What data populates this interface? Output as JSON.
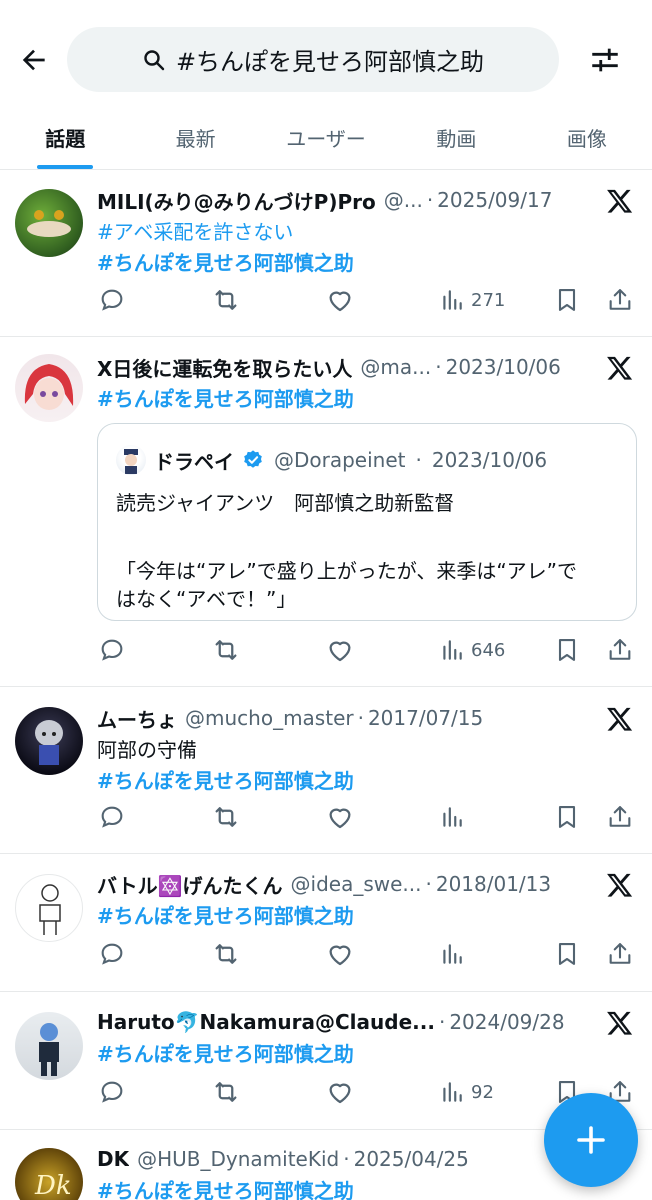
{
  "header": {
    "search_query": "#ちんぽを見せろ阿部慎之助"
  },
  "tabs": [
    {
      "label": "話題",
      "active": true
    },
    {
      "label": "最新",
      "active": false
    },
    {
      "label": "ユーザー",
      "active": false
    },
    {
      "label": "動画",
      "active": false
    },
    {
      "label": "画像",
      "active": false
    }
  ],
  "tweets": [
    {
      "name": "MILI(みり@みりんづけP)Pro",
      "handle": "@...",
      "date": "2025/09/17",
      "lines": [
        "#アベ采配を許さない",
        "#ちんぽを見せろ阿部慎之助"
      ],
      "views": "271"
    },
    {
      "name": "X日後に運転免を取らたい人",
      "handle": "@ma...",
      "date": "2023/10/06",
      "lines": [
        "#ちんぽを見せろ阿部慎之助"
      ],
      "quote": {
        "name": "ドラペイ",
        "handle": "@Dorapeinet",
        "date": "2023/10/06",
        "text_lines": [
          "読売ジャイアンツ　阿部慎之助新監督",
          "「今年は“アレ”で盛り上がったが、来季は“アレ”で",
          "はなく“アベで！”」"
        ]
      },
      "views": "646"
    },
    {
      "name": "ムーちょ",
      "handle": "@mucho_master",
      "date": "2017/07/15",
      "text": "阿部の守備",
      "lines": [
        "#ちんぽを見せろ阿部慎之助"
      ],
      "views": ""
    },
    {
      "name": "バトル🔯げんたくん",
      "handle": "@idea_swe...",
      "date": "2018/01/13",
      "lines": [
        "#ちんぽを見せろ阿部慎之助"
      ],
      "views": ""
    },
    {
      "name": "Haruto🐬Nakamura@Claude...",
      "handle": "",
      "date": "2024/09/28",
      "lines": [
        "#ちんぽを見せろ阿部慎之助"
      ],
      "views": "92"
    },
    {
      "name": "DK",
      "handle": "@HUB_DynamiteKid",
      "date": "2025/04/25",
      "lines": [
        "#ちんぽを見せろ阿部慎之助"
      ],
      "views": ""
    }
  ],
  "colors": {
    "accent": "#1d9bf0",
    "secondary_text": "#536471",
    "divider": "#e7e9ea"
  },
  "icons": {
    "back": "arrow-left-icon",
    "search": "search-icon",
    "filter": "sliders-icon",
    "reply": "reply-icon",
    "retweet": "retweet-icon",
    "like": "heart-icon",
    "views": "bar-chart-icon",
    "bookmark": "bookmark-icon",
    "share": "share-icon",
    "brand": "x-logo-icon",
    "compose": "plus-icon"
  }
}
